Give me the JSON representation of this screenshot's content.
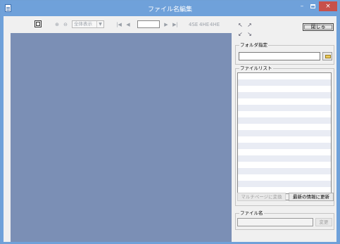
{
  "window": {
    "title": "ファイル名編集",
    "minimize_label": "–",
    "close_label": "×"
  },
  "toolbar": {
    "zoom_select_value": "全体表示",
    "zoom_select_arrow": "▼",
    "zoom_in_label": "⊕",
    "zoom_out_label": "⊖",
    "first_page_label": "|◀",
    "prev_page_label": "◀",
    "next_page_label": "▶",
    "last_page_label": "▶|",
    "page_input_value": "",
    "tool1_label": "4SE",
    "tool2_label": "4HE",
    "tool3_label": "4HE"
  },
  "right_panel": {
    "rotate_up_left": "↖",
    "rotate_up_right": "↗",
    "rotate_down_left": "↙",
    "rotate_down_right": "↘",
    "close_button_label": "閉じる",
    "folder_group_label": "フォルダ指定",
    "folder_input_value": "",
    "file_list_group_label": "ファイルリスト",
    "file_list_rows": [
      "",
      "",
      "",
      "",
      "",
      "",
      "",
      "",
      "",
      "",
      "",
      "",
      "",
      "",
      "",
      "",
      "",
      "",
      ""
    ],
    "scroll_left": "<",
    "scroll_right": ">",
    "multipage_button_label": "マルチページに変換",
    "refresh_button_label": "最新の情報に更新",
    "filename_group_label": "ファイル名",
    "filename_input_value": "",
    "change_button_label": "変更"
  }
}
